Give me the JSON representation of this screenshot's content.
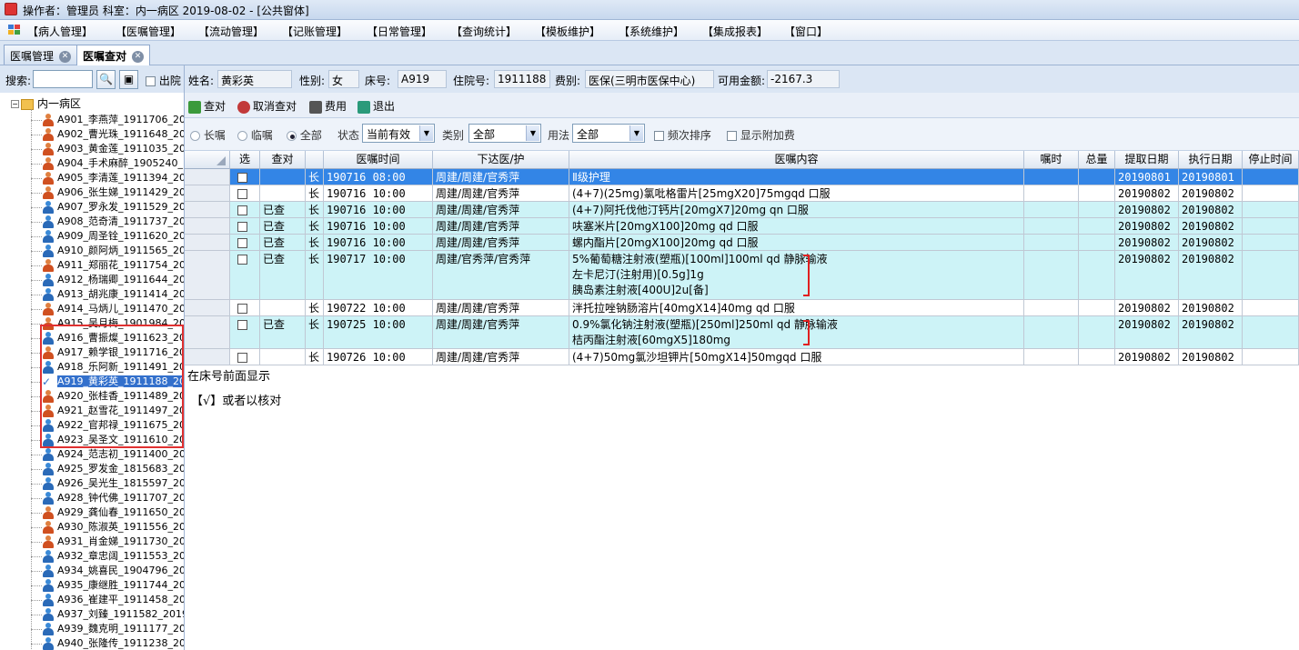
{
  "titlebar": {
    "text": "操作者：管理员  科室：内一病区  2019-08-02 - [公共窗体]"
  },
  "menu": [
    "【病人管理】",
    "【医嘱管理】",
    "【流动管理】",
    "【记账管理】",
    "【日常管理】",
    "【查询统计】",
    "【模板维护】",
    "【系统维护】",
    "【集成报表】",
    "【窗口】"
  ],
  "tabs": [
    {
      "label": "医嘱管理"
    },
    {
      "label": "医嘱查对"
    }
  ],
  "search": {
    "label": "搜索:",
    "value": "",
    "discharge_label": "出院"
  },
  "tree": {
    "root": "内一病区",
    "patients": [
      {
        "label": "A901_李燕萍_1911706_20",
        "gender": "f"
      },
      {
        "label": "A902_曹光珠_1911648_20",
        "gender": "f"
      },
      {
        "label": "A903_黄金莲_1911035_20",
        "gender": "f"
      },
      {
        "label": "A904_手术麻醉_1905240_",
        "gender": "f"
      },
      {
        "label": "A905_李清莲_1911394_20",
        "gender": "f"
      },
      {
        "label": "A906_张生娣_1911429_20",
        "gender": "f"
      },
      {
        "label": "A907_罗永发_1911529_20",
        "gender": "m"
      },
      {
        "label": "A908_范奇清_1911737_20",
        "gender": "m"
      },
      {
        "label": "A909_周圣铨_1911620_20",
        "gender": "m"
      },
      {
        "label": "A910_颜阿炳_1911565_20",
        "gender": "m"
      },
      {
        "label": "A911_郑丽花_1911754_20",
        "gender": "f"
      },
      {
        "label": "A912_杨瑞卿_1911644_20",
        "gender": "m"
      },
      {
        "label": "A913_胡兆康_1911414_20",
        "gender": "m"
      },
      {
        "label": "A914_马炳儿_1911470_20",
        "gender": "f"
      },
      {
        "label": "A915_吴月梅_1901984_20",
        "gender": "f"
      },
      {
        "label": "A916_曹振燦_1911623_20",
        "gender": "m"
      },
      {
        "label": "A917_赖学银_1911716_20",
        "gender": "f"
      },
      {
        "label": "A918_乐阿新_1911491_20",
        "gender": "m"
      },
      {
        "label": "A919_黄彩英_1911188_20",
        "gender": "check",
        "selected": true
      },
      {
        "label": "A920_张桂香_1911489_20",
        "gender": "f"
      },
      {
        "label": "A921_赵雪花_1911497_20",
        "gender": "f"
      },
      {
        "label": "A922_官邦禄_1911675_20",
        "gender": "m"
      },
      {
        "label": "A923_吴圣文_1911610_20",
        "gender": "m"
      },
      {
        "label": "A924_范志初_1911400_20",
        "gender": "m"
      },
      {
        "label": "A925_罗发金_1815683_20",
        "gender": "m"
      },
      {
        "label": "A926_吴光生_1815597_20",
        "gender": "m"
      },
      {
        "label": "A928_钟代佛_1911707_20",
        "gender": "m"
      },
      {
        "label": "A929_龚仙春_1911650_20",
        "gender": "f"
      },
      {
        "label": "A930_陈淑英_1911556_20",
        "gender": "f"
      },
      {
        "label": "A931_肖金娣_1911730_20",
        "gender": "f"
      },
      {
        "label": "A932_章忠阔_1911553_20",
        "gender": "m"
      },
      {
        "label": "A934_姚喜民_1904796_20",
        "gender": "m"
      },
      {
        "label": "A935_康继胜_1911744_20",
        "gender": "m"
      },
      {
        "label": "A936_崔建平_1911458_20",
        "gender": "m"
      },
      {
        "label": "A937_刘臻_1911582_2019",
        "gender": "m"
      },
      {
        "label": "A939_魏克明_1911177_20",
        "gender": "m"
      },
      {
        "label": "A940_张隆传_1911238_20",
        "gender": "m"
      }
    ]
  },
  "info": {
    "name_label": "姓名:",
    "name": "黄彩英",
    "gender_label": "性别:",
    "gender": "女",
    "bed_label": "床号:",
    "bed": "A919",
    "admission_label": "住院号:",
    "admission": "1911188",
    "fee_label": "费别:",
    "fee": "医保(三明市医保中心)",
    "balance_label": "可用金额:",
    "balance": "-2167.3"
  },
  "toolbar": {
    "check": "查对",
    "cancel": "取消查对",
    "cost": "费用",
    "exit": "退出"
  },
  "filters": {
    "long": "长嘱",
    "temp": "临嘱",
    "all": "全部",
    "status_label": "状态",
    "status": "当前有效",
    "category_label": "类别",
    "category": "全部",
    "usage_label": "用法",
    "usage": "全部",
    "freq_sort": "频次排序",
    "show_extra": "显示附加费"
  },
  "columns": [
    "选",
    "查对",
    "",
    "医嘱时间",
    "下达医/护",
    "医嘱内容",
    "嘱时",
    "总量",
    "提取日期",
    "执行日期",
    "停止时间"
  ],
  "rows": [
    {
      "sel": false,
      "checked": "",
      "type": "长",
      "time": "190716 08:00",
      "doctor": "周建/周建/官秀萍",
      "content": [
        "Ⅱ级护理"
      ],
      "fetch": "20190801",
      "exec": "20190801"
    },
    {
      "sel": false,
      "checked": "",
      "type": "长",
      "time": "190716 10:00",
      "doctor": "周建/周建/官秀萍",
      "content": [
        "(4+7)(25mg)氯吡格雷片[25mgX20]75mgqd 口服"
      ],
      "fetch": "20190802",
      "exec": "20190802"
    },
    {
      "sel": false,
      "checked": "已查",
      "type": "长",
      "time": "190716 10:00",
      "doctor": "周建/周建/官秀萍",
      "content": [
        "(4+7)阿托伐他汀钙片[20mgX7]20mg qn 口服"
      ],
      "fetch": "20190802",
      "exec": "20190802"
    },
    {
      "sel": false,
      "checked": "已查",
      "type": "长",
      "time": "190716 10:00",
      "doctor": "周建/周建/官秀萍",
      "content": [
        "呋塞米片[20mgX100]20mg qd 口服"
      ],
      "fetch": "20190802",
      "exec": "20190802"
    },
    {
      "sel": false,
      "checked": "已查",
      "type": "长",
      "time": "190716 10:00",
      "doctor": "周建/周建/官秀萍",
      "content": [
        "螺内酯片[20mgX100]20mg qd 口服"
      ],
      "fetch": "20190802",
      "exec": "20190802"
    },
    {
      "sel": false,
      "checked": "已查",
      "type": "长",
      "time": "190717 10:00",
      "doctor": "周建/官秀萍/官秀萍",
      "content": [
        "5%葡萄糖注射液(塑瓶)[100ml]100ml qd 静脉输液",
        "左卡尼汀(注射用)[0.5g]1g",
        "胰岛素注射液[400U]2u[备]"
      ],
      "fetch": "20190802",
      "exec": "20190802"
    },
    {
      "sel": false,
      "checked": "",
      "type": "长",
      "time": "190722 10:00",
      "doctor": "周建/周建/官秀萍",
      "content": [
        "泮托拉唑钠肠溶片[40mgX14]40mg qd 口服"
      ],
      "fetch": "20190802",
      "exec": "20190802"
    },
    {
      "sel": false,
      "checked": "已查",
      "type": "长",
      "time": "190725 10:00",
      "doctor": "周建/周建/官秀萍",
      "content": [
        "0.9%氯化钠注射液(塑瓶)[250ml]250ml qd 静脉输液",
        "桔丙酯注射液[60mgX5]180mg"
      ],
      "fetch": "20190802",
      "exec": "20190802"
    },
    {
      "sel": false,
      "checked": "",
      "type": "长",
      "time": "190726 10:00",
      "doctor": "周建/周建/官秀萍",
      "content": [
        "(4+7)50mg氯沙坦钾片[50mgX14]50mgqd 口服"
      ],
      "fetch": "20190802",
      "exec": "20190802"
    }
  ],
  "annotations": [
    "在床号前面显示",
    "【√】或者以核对"
  ],
  "colors": {
    "accent": "#3385e6",
    "row_tint": "#cdf3f7",
    "highlight_box": "#e03030"
  }
}
